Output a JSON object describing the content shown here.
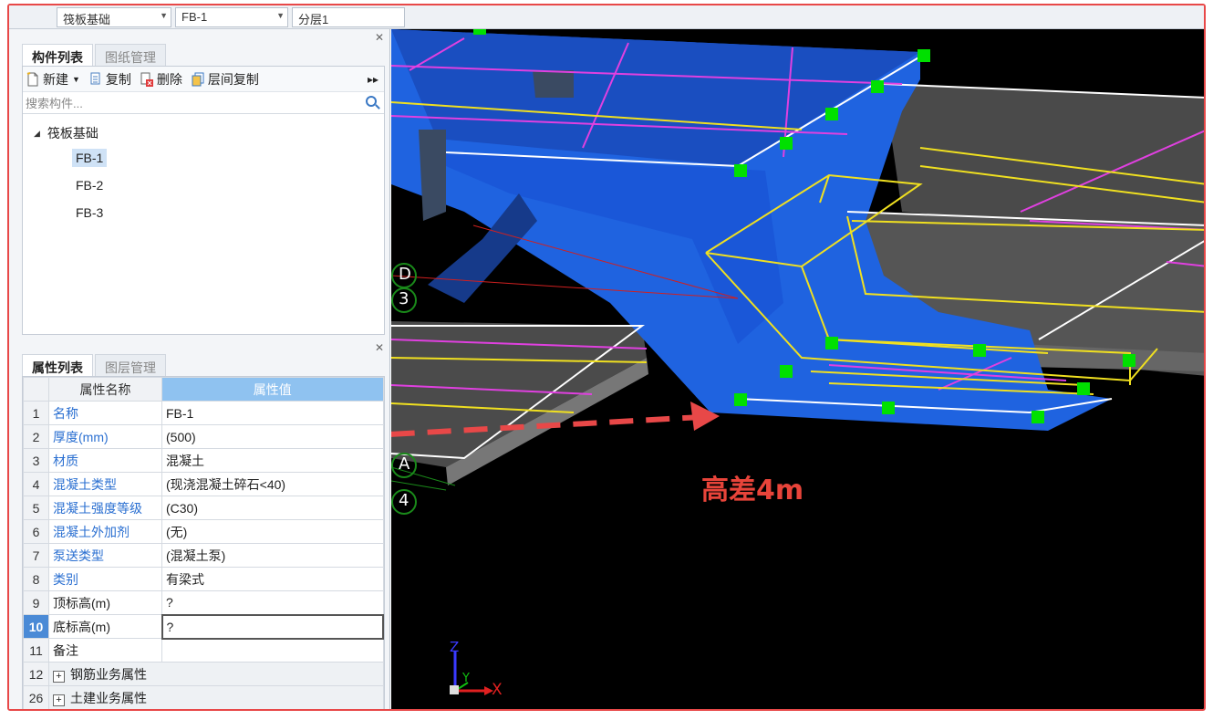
{
  "toolbar": {
    "combo1": "筏板基础",
    "combo2": "FB-1",
    "combo3": "分层1"
  },
  "component_panel": {
    "tabs": [
      "构件列表",
      "图纸管理"
    ],
    "buttons": {
      "new": "新建",
      "copy": "复制",
      "delete": "删除",
      "floor_copy": "层间复制"
    },
    "search_placeholder": "搜索构件...",
    "tree_root": "筏板基础",
    "items": [
      "FB-1",
      "FB-2",
      "FB-3"
    ],
    "selected": "FB-1"
  },
  "property_panel": {
    "tabs": [
      "属性列表",
      "图层管理"
    ],
    "header_name": "属性名称",
    "header_value": "属性值",
    "rows": [
      {
        "no": "1",
        "name": "名称",
        "value": "FB-1"
      },
      {
        "no": "2",
        "name": "厚度(mm)",
        "value": "(500)"
      },
      {
        "no": "3",
        "name": "材质",
        "value": "混凝土"
      },
      {
        "no": "4",
        "name": "混凝土类型",
        "value": "(现浇混凝土碎石<40)"
      },
      {
        "no": "5",
        "name": "混凝土强度等级",
        "value": "(C30)"
      },
      {
        "no": "6",
        "name": "混凝土外加剂",
        "value": "(无)"
      },
      {
        "no": "7",
        "name": "泵送类型",
        "value": "(混凝土泵)"
      },
      {
        "no": "8",
        "name": "类别",
        "value": "有梁式"
      },
      {
        "no": "9",
        "name": "顶标高(m)",
        "value": "?"
      },
      {
        "no": "10",
        "name": "底标高(m)",
        "value": "?"
      },
      {
        "no": "11",
        "name": "备注",
        "value": ""
      },
      {
        "no": "12",
        "name": "钢筋业务属性",
        "value": ""
      },
      {
        "no": "26",
        "name": "土建业务属性",
        "value": ""
      }
    ]
  },
  "view": {
    "annotation": "高差4m",
    "axis_labels": {
      "z": "Z",
      "y": "Y",
      "x": "X"
    },
    "grid_labels": [
      "D",
      "3",
      "A",
      "4"
    ]
  }
}
